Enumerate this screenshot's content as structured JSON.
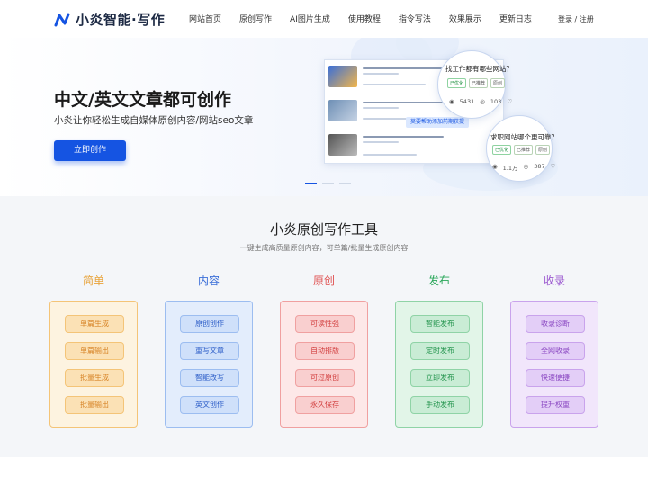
{
  "header": {
    "logo_text": "小炎智能·写作",
    "nav": [
      "网站首页",
      "原创写作",
      "AI图片生成",
      "使用教程",
      "指令写法",
      "效果展示",
      "更新日志"
    ],
    "auth": "登录 / 注册"
  },
  "hero": {
    "title": "中文/英文文章都可创作",
    "subtitle": "小炎让你轻松生成自媒体原创内容/网站seo文章",
    "cta": "立即创作",
    "preview_tag": "莫要帮助添加前期获提",
    "bubble1": {
      "question": "找工作都有哪些网站？",
      "chips": [
        "已优化",
        "已推荐",
        "原创"
      ],
      "views": "5431",
      "likes": "103"
    },
    "bubble2": {
      "question": "求职网站哪个更可靠？",
      "chips": [
        "已优化",
        "已推荐",
        "原创"
      ],
      "views": "1.1万",
      "likes": "387"
    }
  },
  "tools": {
    "title": "小炎原创写作工具",
    "subtitle": "一键生成高质量原创内容，可单篇/批量生成原创内容",
    "columns": [
      {
        "title": "简单",
        "color": "#e8a33a",
        "bg": "#fdf3e0",
        "border": "#f4c477",
        "btn_bg": "#fbe1b5",
        "btn_text": "#d8862a",
        "items": [
          "单篇生成",
          "单篇输出",
          "批量生成",
          "批量输出"
        ]
      },
      {
        "title": "内容",
        "color": "#3b6fd8",
        "bg": "#e3edfc",
        "border": "#9cbdf0",
        "btn_bg": "#cfe0fa",
        "btn_text": "#2d5ec8",
        "items": [
          "原创创作",
          "重写文章",
          "智能改写",
          "英文创作"
        ]
      },
      {
        "title": "原创",
        "color": "#e05252",
        "bg": "#fde8e8",
        "border": "#f0a0a0",
        "btn_bg": "#f9cfcf",
        "btn_text": "#d23f3f",
        "items": [
          "可读性强",
          "自动排版",
          "可过原创",
          "永久保存"
        ]
      },
      {
        "title": "发布",
        "color": "#2aa75a",
        "bg": "#e2f5e8",
        "border": "#8fd3a6",
        "btn_bg": "#c9ecd5",
        "btn_text": "#23944d",
        "items": [
          "智能发布",
          "定时发布",
          "立即发布",
          "手动发布"
        ]
      },
      {
        "title": "收录",
        "color": "#9b59d0",
        "bg": "#f1e6fb",
        "border": "#c9a3ec",
        "btn_bg": "#e3cef7",
        "btn_text": "#8a47c2",
        "items": [
          "收录诊断",
          "全网收录",
          "快速便捷",
          "提升权重"
        ]
      }
    ]
  }
}
